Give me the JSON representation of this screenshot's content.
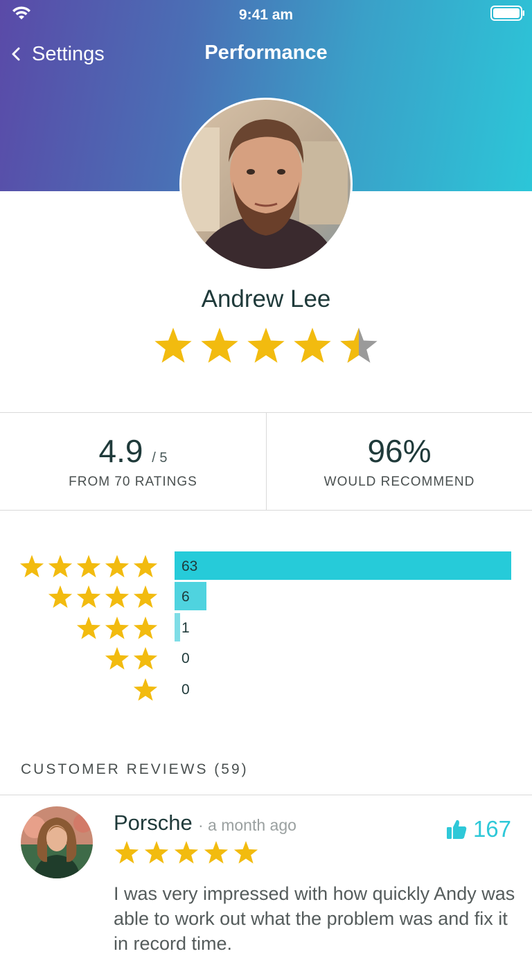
{
  "status_bar": {
    "time": "9:41 am"
  },
  "nav": {
    "back_label": "Settings",
    "title": "Performance"
  },
  "profile": {
    "name": "Andrew Lee",
    "rating_stars": 4.5
  },
  "stats": {
    "rating": {
      "value": "4.9",
      "suffix": "/ 5",
      "label": "FROM 70 RATINGS"
    },
    "recommend": {
      "value": "96%",
      "label": "WOULD RECOMMEND"
    }
  },
  "distribution": [
    {
      "stars": 5,
      "count": "63",
      "fraction": 1.0,
      "color": "#26cbd9"
    },
    {
      "stars": 4,
      "count": "6",
      "fraction": 0.095,
      "color": "#4fd3df"
    },
    {
      "stars": 3,
      "count": "1",
      "fraction": 0.016,
      "color": "#7fdde6"
    },
    {
      "stars": 2,
      "count": "0",
      "fraction": 0,
      "color": "#7fdde6"
    },
    {
      "stars": 1,
      "count": "0",
      "fraction": 0,
      "color": "#7fdde6"
    }
  ],
  "reviews": {
    "title": "CUSTOMER REVIEWS (59)",
    "items": [
      {
        "name": "Porsche",
        "time": "· a month ago",
        "likes": "167",
        "stars": 5,
        "text": "I was very impressed with how quickly Andy was able to work out what the problem was and fix it in record time."
      }
    ]
  },
  "colors": {
    "star": "#f2bb0f",
    "star_empty": "#9a9a9a",
    "accent": "#2ec8d8",
    "header_start": "#5a4aa8",
    "header_end": "#2cc6d8"
  },
  "icons": {
    "back": "chevron-left-icon",
    "likes": "thumbs-up-icon",
    "star": "star-icon",
    "wifi": "wifi-icon",
    "battery": "battery-icon"
  }
}
